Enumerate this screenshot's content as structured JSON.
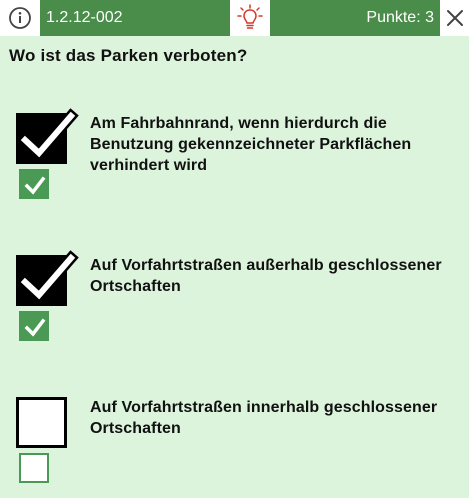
{
  "header": {
    "question_id": "1.2.12-002",
    "points": "Punkte: 3",
    "accent": "#4a8c4a",
    "hint_color": "#d23a2a"
  },
  "question": "Wo ist das Parken verboten?",
  "answers": [
    {
      "text": "Am Fahrbahnrand, wenn hierdurch die Benutzung gekennzeichneter Parkflächen verhindert wird",
      "selected": true,
      "correct": true
    },
    {
      "text": "Auf Vorfahrtstraßen außerhalb geschlossener Ortschaften",
      "selected": true,
      "correct": true
    },
    {
      "text": "Auf Vorfahrtstraßen innerhalb geschlossener Ortschaften",
      "selected": false,
      "correct": false
    }
  ],
  "icons": [
    "info-icon",
    "lightbulb-icon",
    "close-icon",
    "checkmark-icon"
  ]
}
